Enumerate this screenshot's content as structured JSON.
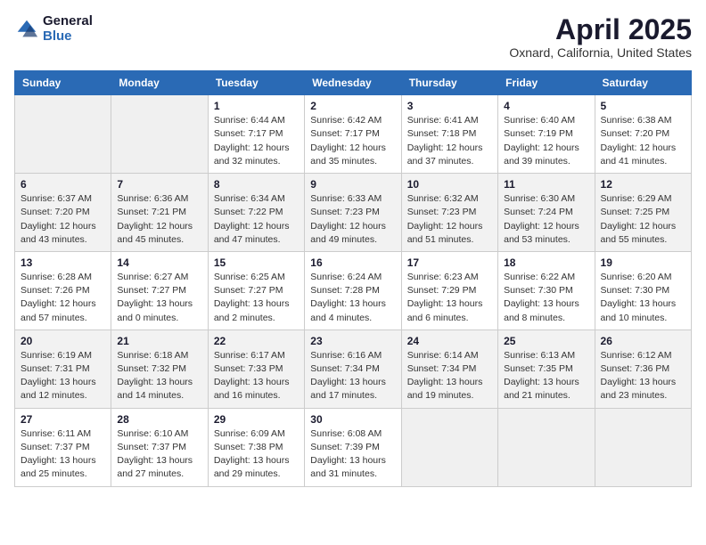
{
  "logo": {
    "general": "General",
    "blue": "Blue"
  },
  "title": "April 2025",
  "location": "Oxnard, California, United States",
  "days_of_week": [
    "Sunday",
    "Monday",
    "Tuesday",
    "Wednesday",
    "Thursday",
    "Friday",
    "Saturday"
  ],
  "weeks": [
    [
      {
        "num": "",
        "info": ""
      },
      {
        "num": "",
        "info": ""
      },
      {
        "num": "1",
        "info": "Sunrise: 6:44 AM\nSunset: 7:17 PM\nDaylight: 12 hours and 32 minutes."
      },
      {
        "num": "2",
        "info": "Sunrise: 6:42 AM\nSunset: 7:17 PM\nDaylight: 12 hours and 35 minutes."
      },
      {
        "num": "3",
        "info": "Sunrise: 6:41 AM\nSunset: 7:18 PM\nDaylight: 12 hours and 37 minutes."
      },
      {
        "num": "4",
        "info": "Sunrise: 6:40 AM\nSunset: 7:19 PM\nDaylight: 12 hours and 39 minutes."
      },
      {
        "num": "5",
        "info": "Sunrise: 6:38 AM\nSunset: 7:20 PM\nDaylight: 12 hours and 41 minutes."
      }
    ],
    [
      {
        "num": "6",
        "info": "Sunrise: 6:37 AM\nSunset: 7:20 PM\nDaylight: 12 hours and 43 minutes."
      },
      {
        "num": "7",
        "info": "Sunrise: 6:36 AM\nSunset: 7:21 PM\nDaylight: 12 hours and 45 minutes."
      },
      {
        "num": "8",
        "info": "Sunrise: 6:34 AM\nSunset: 7:22 PM\nDaylight: 12 hours and 47 minutes."
      },
      {
        "num": "9",
        "info": "Sunrise: 6:33 AM\nSunset: 7:23 PM\nDaylight: 12 hours and 49 minutes."
      },
      {
        "num": "10",
        "info": "Sunrise: 6:32 AM\nSunset: 7:23 PM\nDaylight: 12 hours and 51 minutes."
      },
      {
        "num": "11",
        "info": "Sunrise: 6:30 AM\nSunset: 7:24 PM\nDaylight: 12 hours and 53 minutes."
      },
      {
        "num": "12",
        "info": "Sunrise: 6:29 AM\nSunset: 7:25 PM\nDaylight: 12 hours and 55 minutes."
      }
    ],
    [
      {
        "num": "13",
        "info": "Sunrise: 6:28 AM\nSunset: 7:26 PM\nDaylight: 12 hours and 57 minutes."
      },
      {
        "num": "14",
        "info": "Sunrise: 6:27 AM\nSunset: 7:27 PM\nDaylight: 13 hours and 0 minutes."
      },
      {
        "num": "15",
        "info": "Sunrise: 6:25 AM\nSunset: 7:27 PM\nDaylight: 13 hours and 2 minutes."
      },
      {
        "num": "16",
        "info": "Sunrise: 6:24 AM\nSunset: 7:28 PM\nDaylight: 13 hours and 4 minutes."
      },
      {
        "num": "17",
        "info": "Sunrise: 6:23 AM\nSunset: 7:29 PM\nDaylight: 13 hours and 6 minutes."
      },
      {
        "num": "18",
        "info": "Sunrise: 6:22 AM\nSunset: 7:30 PM\nDaylight: 13 hours and 8 minutes."
      },
      {
        "num": "19",
        "info": "Sunrise: 6:20 AM\nSunset: 7:30 PM\nDaylight: 13 hours and 10 minutes."
      }
    ],
    [
      {
        "num": "20",
        "info": "Sunrise: 6:19 AM\nSunset: 7:31 PM\nDaylight: 13 hours and 12 minutes."
      },
      {
        "num": "21",
        "info": "Sunrise: 6:18 AM\nSunset: 7:32 PM\nDaylight: 13 hours and 14 minutes."
      },
      {
        "num": "22",
        "info": "Sunrise: 6:17 AM\nSunset: 7:33 PM\nDaylight: 13 hours and 16 minutes."
      },
      {
        "num": "23",
        "info": "Sunrise: 6:16 AM\nSunset: 7:34 PM\nDaylight: 13 hours and 17 minutes."
      },
      {
        "num": "24",
        "info": "Sunrise: 6:14 AM\nSunset: 7:34 PM\nDaylight: 13 hours and 19 minutes."
      },
      {
        "num": "25",
        "info": "Sunrise: 6:13 AM\nSunset: 7:35 PM\nDaylight: 13 hours and 21 minutes."
      },
      {
        "num": "26",
        "info": "Sunrise: 6:12 AM\nSunset: 7:36 PM\nDaylight: 13 hours and 23 minutes."
      }
    ],
    [
      {
        "num": "27",
        "info": "Sunrise: 6:11 AM\nSunset: 7:37 PM\nDaylight: 13 hours and 25 minutes."
      },
      {
        "num": "28",
        "info": "Sunrise: 6:10 AM\nSunset: 7:37 PM\nDaylight: 13 hours and 27 minutes."
      },
      {
        "num": "29",
        "info": "Sunrise: 6:09 AM\nSunset: 7:38 PM\nDaylight: 13 hours and 29 minutes."
      },
      {
        "num": "30",
        "info": "Sunrise: 6:08 AM\nSunset: 7:39 PM\nDaylight: 13 hours and 31 minutes."
      },
      {
        "num": "",
        "info": ""
      },
      {
        "num": "",
        "info": ""
      },
      {
        "num": "",
        "info": ""
      }
    ]
  ]
}
